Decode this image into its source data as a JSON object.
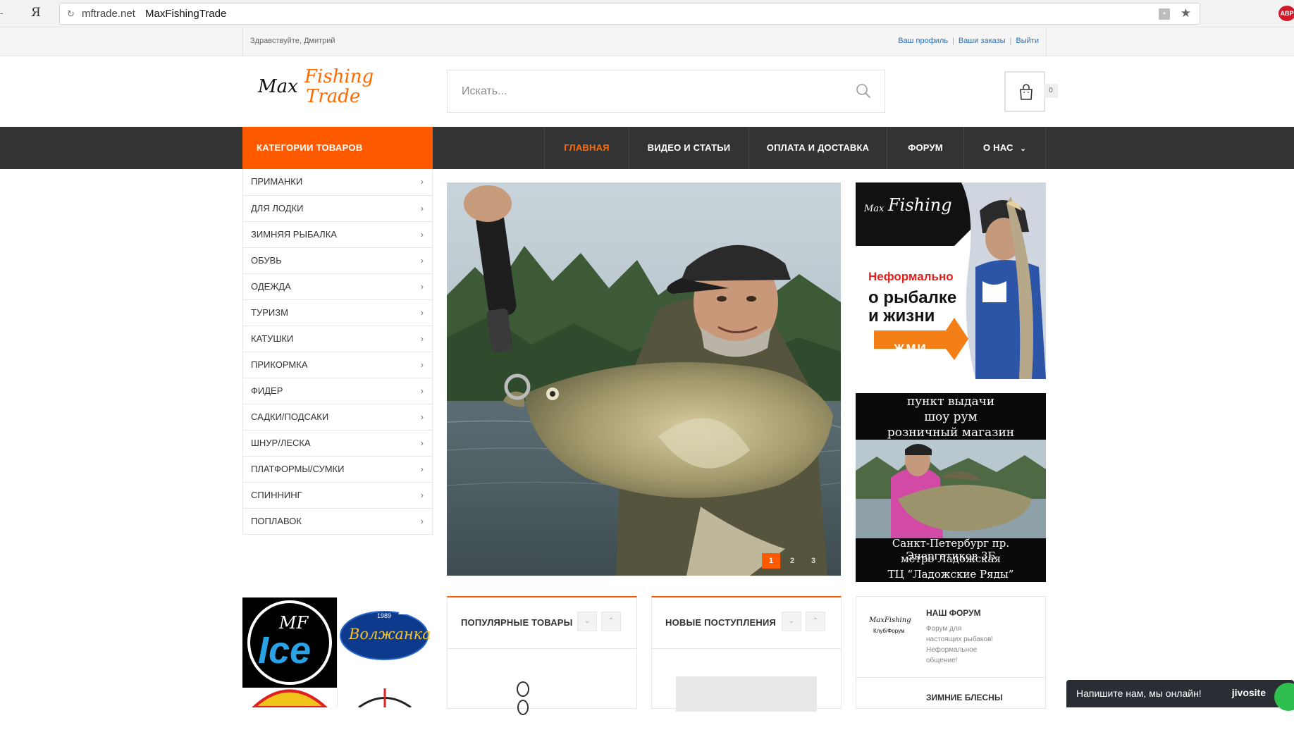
{
  "browser": {
    "back_glyph": "-",
    "yandex_glyph": "Я",
    "domain": "mftrade.net",
    "page_title": "MaxFishingTrade",
    "extension_label": "ABP"
  },
  "top_strip": {
    "greeting": "Здравствуйте, Дмитрий",
    "links": [
      "Ваш профиль",
      "Ваши заказы",
      "Выйти"
    ],
    "separator": "|"
  },
  "header": {
    "logo": {
      "word1": "Max",
      "word2": "Fishing",
      "word3": "Trade"
    },
    "search_placeholder": "Искать...",
    "cart_count": "0"
  },
  "nav": {
    "categories_label": "КАТЕГОРИИ ТОВАРОВ",
    "items": [
      "ГЛАВНАЯ",
      "ВИДЕО И СТАТЬИ",
      "ОПЛАТА И ДОСТАВКА",
      "ФОРУМ",
      "О НАС"
    ],
    "active_index": 0
  },
  "categories": [
    "ПРИМАНКИ",
    "ДЛЯ ЛОДКИ",
    "ЗИМНЯЯ РЫБАЛКА",
    "ОБУВЬ",
    "ОДЕЖДА",
    "ТУРИЗМ",
    "КАТУШКИ",
    "ПРИКОРМКА",
    "ФИДЕР",
    "САДКИ/ПОДСАКИ",
    "ШНУР/ЛЕСКА",
    "ПЛАТФОРМЫ/СУМКИ",
    "СПИННИНГ",
    "ПОПЛАВОК"
  ],
  "slider": {
    "pages": [
      "1",
      "2",
      "3"
    ],
    "active": "1"
  },
  "banner1": {
    "logo_max": "Max",
    "logo_fishing": "Fishing",
    "line1": "Неформально",
    "line2": "о рыбалке",
    "line3": "и жизни",
    "button": "ЖМИ"
  },
  "banner2": {
    "top_lines": [
      "пункт выдачи",
      "шоу рум",
      "розничный магазин"
    ],
    "bottom_lines": [
      "Санкт-Петербург пр. Энергетиков 3Б",
      "метро Ладожская",
      "ТЦ “Ладожские Ряды”"
    ]
  },
  "brands": {
    "mf_ice_top": "MF",
    "mf_ice_bottom": "Ice",
    "volzhanka_year": "1989",
    "volzhanka_name": "Волжанка"
  },
  "widgets": {
    "popular": "ПОПУЛЯРНЫЕ ТОВАРЫ",
    "new_arrivals": "НОВЫЕ ПОСТУПЛЕНИЯ"
  },
  "forum": {
    "title": "НАШ ФОРУМ",
    "description": "Форум для настоящих рыбаков! Неформальное общение!",
    "logo_text1": "MaxFishing",
    "logo_text2": "Клуб/Форум",
    "next_title": "ЗИМНИЕ БЛЕСНЫ"
  },
  "chat": {
    "text": "Напишите нам, мы онлайн!",
    "brand": "jivosite"
  },
  "colors": {
    "accent": "#ff5a00",
    "navbar": "#333333",
    "link": "#2a6fb8"
  }
}
